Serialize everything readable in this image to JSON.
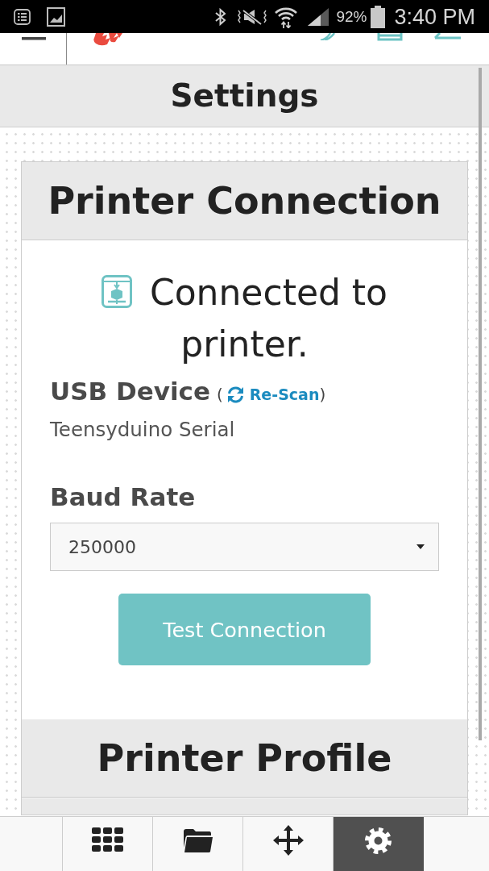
{
  "status_bar": {
    "battery": "92%",
    "time": "3:40 PM"
  },
  "page_title": "Settings",
  "sections": [
    {
      "kind": "connection",
      "title": "Printer Connection",
      "status": "Connected to printer.",
      "usb_device": {
        "label": "USB Device",
        "open": "(",
        "link": "Re-Scan",
        "close": ")",
        "value": "Teensyduino Serial"
      },
      "baud_rate": {
        "label": "Baud Rate",
        "value": "250000"
      },
      "button": "Test Connection"
    },
    {
      "kind": "header",
      "title": "Printer Profile"
    }
  ],
  "bottom_nav": [
    {
      "kind": "grid",
      "selected": false
    },
    {
      "kind": "folder",
      "selected": false
    },
    {
      "kind": "move",
      "selected": false
    },
    {
      "kind": "settings",
      "selected": true
    }
  ]
}
